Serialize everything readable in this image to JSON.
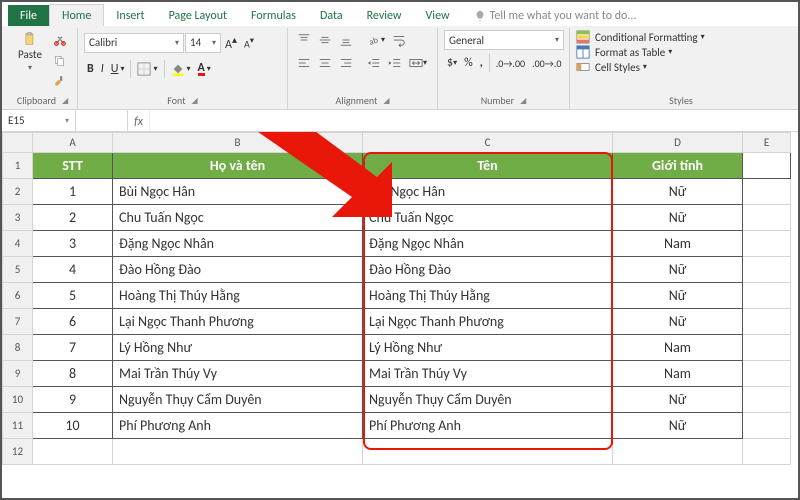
{
  "tabs": {
    "file": "File",
    "home": "Home",
    "insert": "Insert",
    "pagelayout": "Page Layout",
    "formulas": "Formulas",
    "data": "Data",
    "review": "Review",
    "view": "View",
    "tell": "Tell me what you want to do..."
  },
  "ribbon": {
    "paste": "Paste",
    "clipboard": "Clipboard",
    "font_name": "Calibri",
    "font_size": "14",
    "font_group": "Font",
    "alignment": "Alignment",
    "number_format": "General",
    "number_group": "Number",
    "cond": "Conditional Formatting",
    "fmt_table": "Format as Table",
    "cell_styles": "Cell Styles",
    "styles_group": "Styles"
  },
  "namebox": "E15",
  "colhdr": {
    "A": "A",
    "B": "B",
    "C": "C",
    "D": "D",
    "E": "E"
  },
  "headers": {
    "stt": "STT",
    "hovaten": "Họ và tên",
    "ten": "Tên",
    "gioitinh": "Giới tính"
  },
  "rows": [
    {
      "n": "1",
      "stt": "1",
      "name": "Bùi Ngọc Hân",
      "ten": "Bùi Ngọc Hân",
      "sex": "Nữ"
    },
    {
      "n": "2",
      "stt": "2",
      "name": "Chu Tuấn Ngọc",
      "ten": "Chu Tuấn Ngọc",
      "sex": "Nữ"
    },
    {
      "n": "3",
      "stt": "3",
      "name": "Đặng Ngọc Nhân",
      "ten": "Đặng Ngọc Nhân",
      "sex": "Nam"
    },
    {
      "n": "4",
      "stt": "4",
      "name": "Đào Hồng Đào",
      "ten": "Đào Hồng Đào",
      "sex": "Nữ"
    },
    {
      "n": "5",
      "stt": "5",
      "name": "Hoàng Thị Thúy Hằng",
      "ten": "Hoàng Thị Thúy Hằng",
      "sex": "Nữ"
    },
    {
      "n": "6",
      "stt": "6",
      "name": "Lại Ngọc Thanh Phương",
      "ten": "Lại Ngọc Thanh Phương",
      "sex": "Nữ"
    },
    {
      "n": "7",
      "stt": "7",
      "name": "Lý Hồng Như",
      "ten": "Lý Hồng Như",
      "sex": "Nam"
    },
    {
      "n": "8",
      "stt": "8",
      "name": "Mai Trần Thúy Vy",
      "ten": "Mai Trần Thúy Vy",
      "sex": "Nam"
    },
    {
      "n": "9",
      "stt": "9",
      "name": "Nguyễn Thụy Cẩm Duyên",
      "ten": "Nguyễn Thụy Cẩm Duyên",
      "sex": "Nữ"
    },
    {
      "n": "10",
      "stt": "10",
      "name": "Phí Phương Anh",
      "ten": "Phí Phương Anh",
      "sex": "Nữ"
    }
  ],
  "rownums_extra": [
    "11",
    "12"
  ]
}
